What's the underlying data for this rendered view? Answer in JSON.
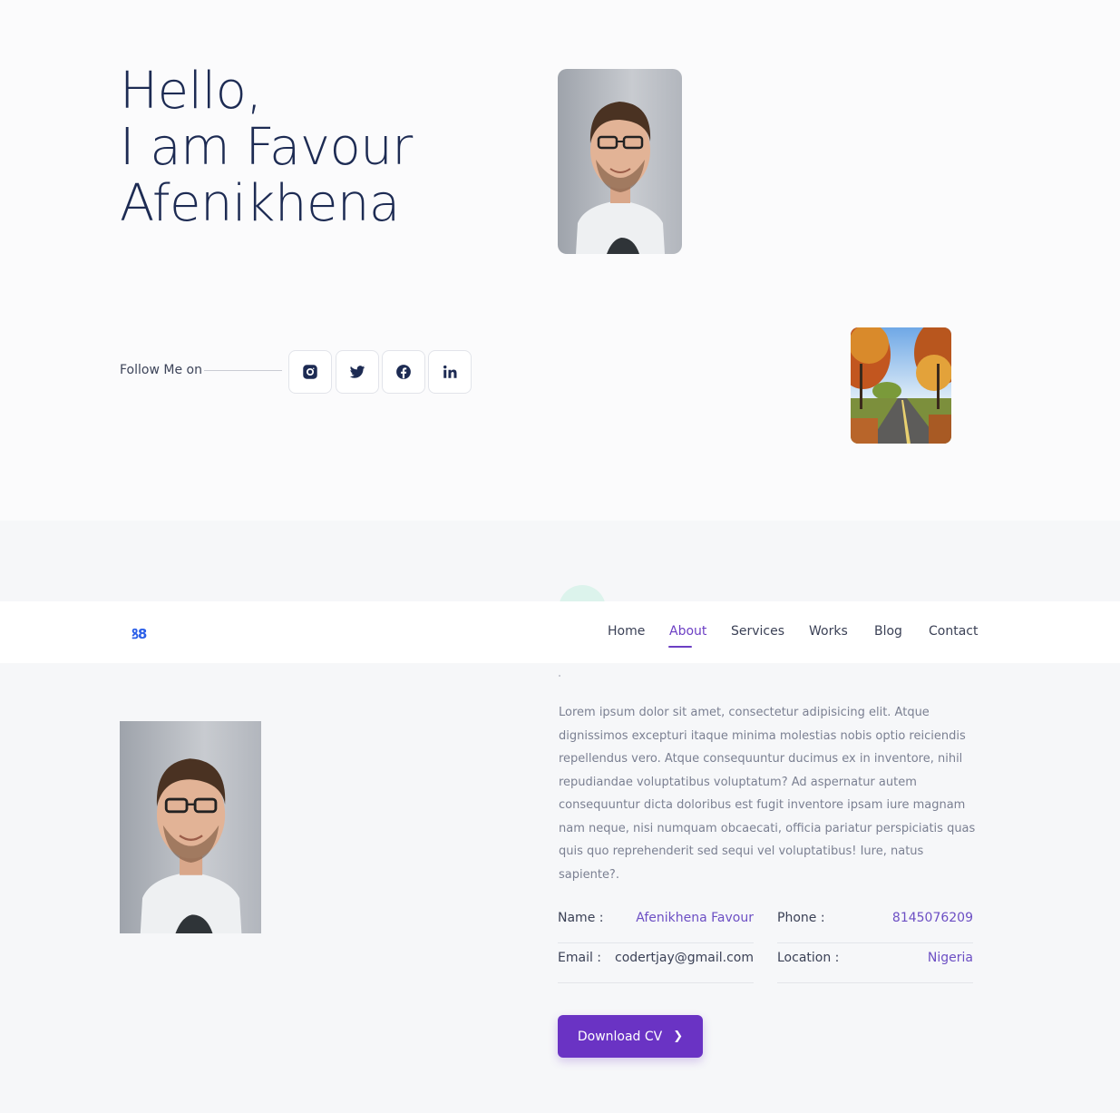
{
  "hero": {
    "title_line1": "Hello,",
    "title_line2": "I am Favour",
    "title_line3": "Afenikhena",
    "follow_label": "Follow Me on",
    "socials": [
      {
        "icon": "instagram-icon"
      },
      {
        "icon": "twitter-icon"
      },
      {
        "icon": "facebook-icon"
      },
      {
        "icon": "linkedin-icon"
      }
    ]
  },
  "navbar": {
    "logo": "ꝸ8",
    "items": [
      {
        "label": "Home"
      },
      {
        "label": "About",
        "active": true
      },
      {
        "label": "Services"
      },
      {
        "label": "Works"
      },
      {
        "label": "Blog"
      },
      {
        "label": "Contact"
      }
    ]
  },
  "about": {
    "text": "Lorem ipsum dolor sit amet, consectetur adipisicing elit. Atque dignissimos excepturi itaque minima molestias nobis optio reiciendis repellendus vero. Atque consequuntur ducimus ex in inventore, nihil repudiandae voluptatibus voluptatum? Ad aspernatur autem consequuntur dicta doloribus est fugit inventore ipsam iure magnam nam neque, nisi numquam obcaecati, officia pariatur perspiciatis quas quis quo reprehenderit sed sequi vel voluptatibus! Iure, natus sapiente?.",
    "info": {
      "name_label": "Name :",
      "name_value": "Afenikhena Favour",
      "phone_label": "Phone :",
      "phone_value": "8145076209",
      "email_label": "Email :",
      "email_value": "codertjay@gmail.com",
      "location_label": "Location :",
      "location_value": "Nigeria"
    },
    "download_label": "Download CV",
    "download_icon": "chevron-right-icon"
  },
  "colors": {
    "accent": "#6a33c4",
    "heading": "#1d2b53",
    "logo": "#2a5ee8"
  }
}
